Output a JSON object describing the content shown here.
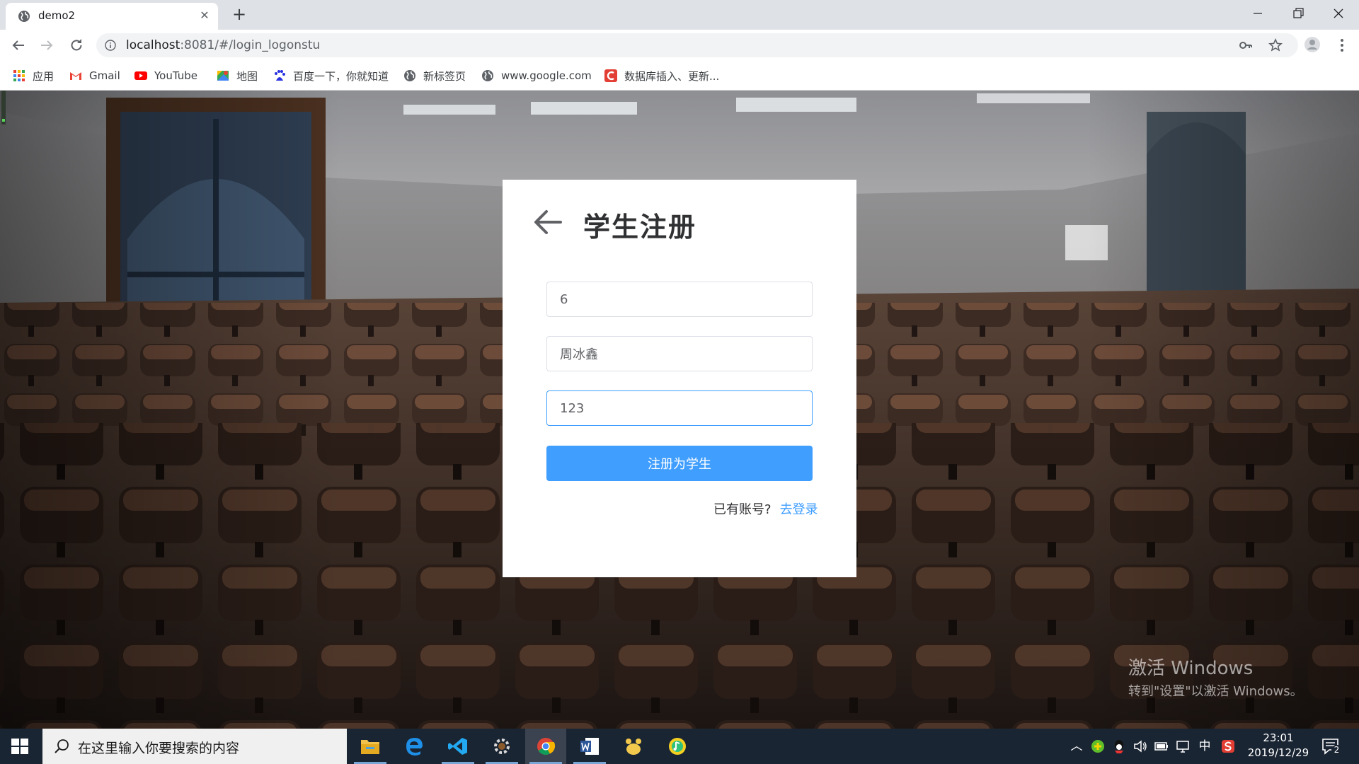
{
  "browser": {
    "tab_title": "demo2",
    "url_host": "localhost",
    "url_path": ":8081/#/login_logonstu",
    "bookmarks": [
      {
        "label": "应用",
        "icon": "apps-grid-icon"
      },
      {
        "label": "Gmail",
        "icon": "gmail-icon"
      },
      {
        "label": "YouTube",
        "icon": "youtube-icon"
      },
      {
        "label": "地图",
        "icon": "maps-icon"
      },
      {
        "label": "百度一下，你就知道",
        "icon": "baidu-icon"
      },
      {
        "label": "新标签页",
        "icon": "globe-icon"
      },
      {
        "label": "www.google.com",
        "icon": "globe-icon"
      },
      {
        "label": "数据库插入、更新...",
        "icon": "csdn-icon"
      }
    ]
  },
  "form": {
    "title": "学生注册",
    "fields": [
      {
        "value": "6"
      },
      {
        "value": "周冰鑫"
      },
      {
        "value": "123"
      }
    ],
    "submit_label": "注册为学生",
    "login_prompt": "已有账号?",
    "login_link": "去登录"
  },
  "watermark": {
    "line1": "激活 Windows",
    "line2": "转到\"设置\"以激活 Windows。"
  },
  "taskbar": {
    "search_placeholder": "在这里输入你要搜索的内容",
    "apps": [
      "file-explorer-icon",
      "edge-icon",
      "vscode-icon",
      "settings-gear-icon",
      "chrome-icon",
      "word-icon",
      "paw-app-icon",
      "qq-music-icon"
    ],
    "ime": "中",
    "time": "23:01",
    "date": "2019/12/29",
    "notification_count": "2"
  },
  "colors": {
    "primary": "#409eff",
    "taskbar": "#1a2533",
    "chrome_frame": "#dee1e6"
  }
}
